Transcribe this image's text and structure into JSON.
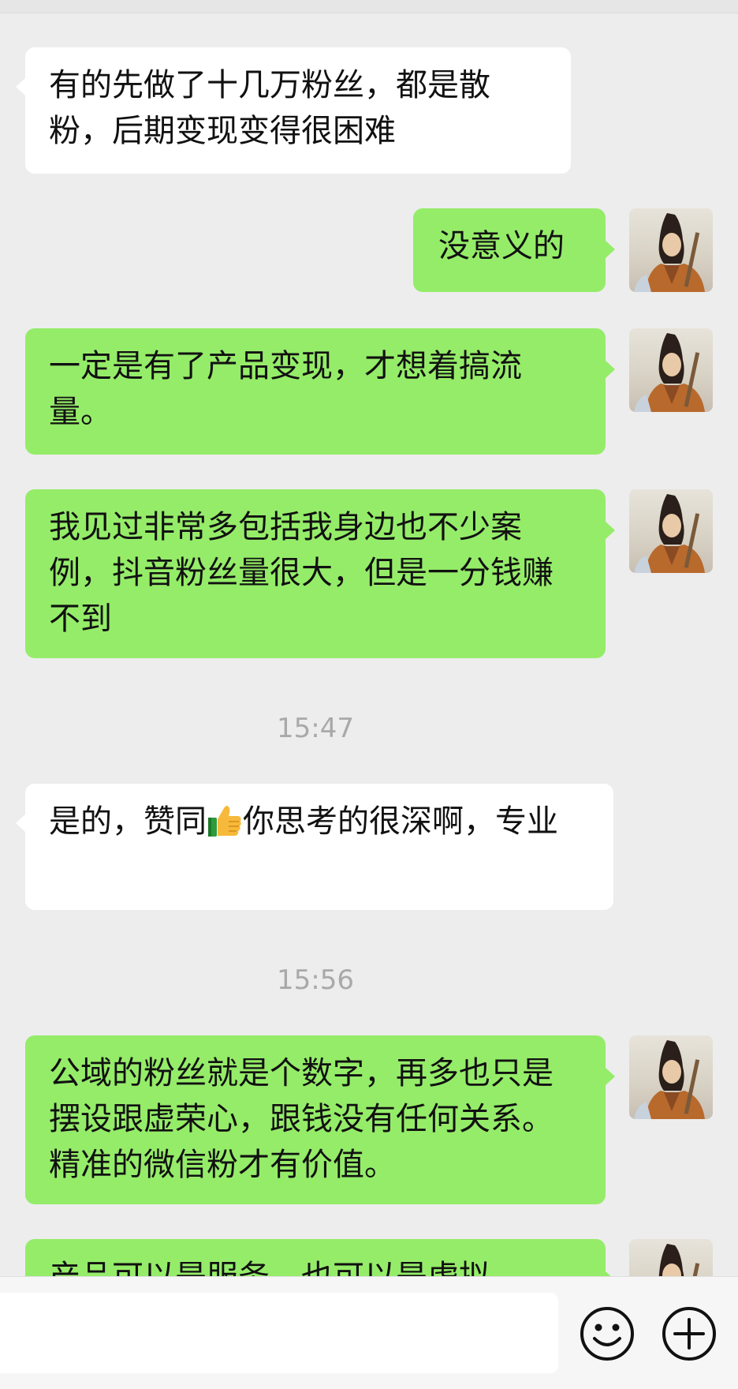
{
  "messages": [
    {
      "side": "left",
      "text": "有的先做了十几万粉丝，都是散粉，后期变现变得很困难"
    },
    {
      "side": "right",
      "text": "没意义的"
    },
    {
      "side": "right",
      "text": "一定是有了产品变现，才想着搞流量。"
    },
    {
      "side": "right",
      "text": "我见过非常多包括我身边也不少案例，抖音粉丝量很大，但是一分钱赚不到"
    },
    {
      "time": "15:47"
    },
    {
      "side": "left",
      "text_before": "是的，赞同",
      "emoji": "thumbs-up",
      "text_after": "你思考的很深啊，专业"
    },
    {
      "time": "15:56"
    },
    {
      "side": "right",
      "text": "公域的粉丝就是个数字，再多也只是摆设跟虚荣心，跟钱没有任何关系。精准的微信粉才有价值。"
    },
    {
      "side": "right",
      "text": "产品可以是服务，也可以是虚拟"
    }
  ],
  "input_bar": {
    "input_value": "",
    "emoji_button_icon": "smiley-icon",
    "more_button_icon": "plus-circle-icon"
  },
  "colors": {
    "background": "#ededed",
    "bubble_in": "#ffffff",
    "bubble_out": "#95ec69",
    "timestamp": "#a9a9a9"
  }
}
